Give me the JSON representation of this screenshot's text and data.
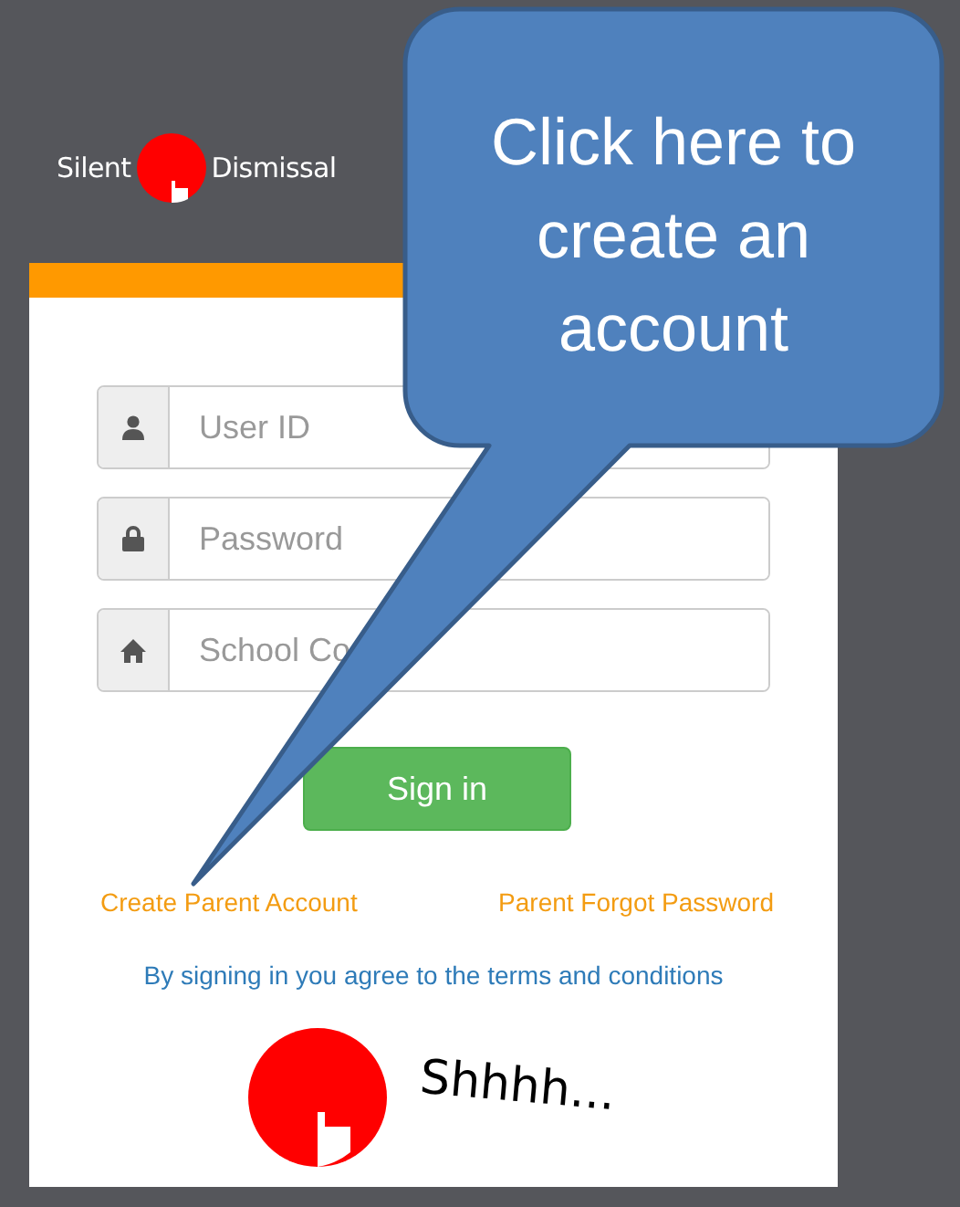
{
  "logo": {
    "word_1": "Silent",
    "word_2": "Dismissal"
  },
  "fields": [
    {
      "kind": "user",
      "placeholder": "User ID"
    },
    {
      "kind": "lock",
      "placeholder": "Password"
    },
    {
      "kind": "home",
      "placeholder": "School Co"
    }
  ],
  "sign_in_button": "Sign in",
  "links": [
    "Create Parent Account",
    "Parent Forgot Password"
  ],
  "terms": "By signing in you agree to the terms and conditions",
  "footer_logo": {
    "text": "Shhhh..."
  },
  "callout": {
    "text": "Click here to create an account"
  }
}
